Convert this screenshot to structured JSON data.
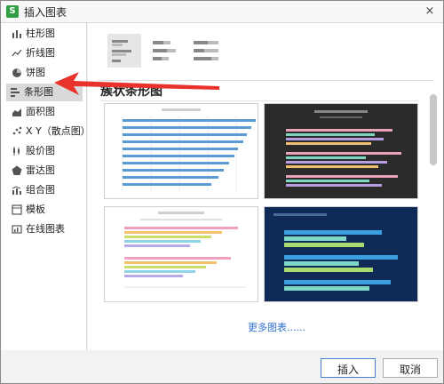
{
  "window": {
    "title": "插入图表",
    "app_icon_letter": "S",
    "close_glyph": "×"
  },
  "sidebar": {
    "items": [
      {
        "label": "柱形图",
        "icon": "column-chart-icon"
      },
      {
        "label": "折线图",
        "icon": "line-chart-icon"
      },
      {
        "label": "饼图",
        "icon": "pie-chart-icon"
      },
      {
        "label": "条形图",
        "icon": "bar-chart-icon",
        "active": true
      },
      {
        "label": "面积图",
        "icon": "area-chart-icon"
      },
      {
        "label": "X Y（散点图）",
        "icon": "scatter-chart-icon"
      },
      {
        "label": "股价图",
        "icon": "stock-chart-icon"
      },
      {
        "label": "雷达图",
        "icon": "radar-chart-icon"
      },
      {
        "label": "组合图",
        "icon": "combo-chart-icon"
      },
      {
        "label": "模板",
        "icon": "template-icon"
      },
      {
        "label": "在线图表",
        "icon": "online-chart-icon"
      }
    ]
  },
  "content": {
    "section_title": "簇状条形图",
    "more_link": "更多图表......",
    "subtypes": [
      "clustered-bar",
      "stacked-bar",
      "percent-stacked-bar"
    ],
    "thumbnails": [
      {
        "style": "light-blue-bars"
      },
      {
        "style": "dark-colorful-bars"
      },
      {
        "style": "light-multicolor-bars"
      },
      {
        "style": "navy-blue-bars"
      }
    ]
  },
  "buttons": {
    "insert": "插入",
    "cancel": "取消"
  },
  "colors": {
    "accent": "#4a7fd6",
    "arrow": "#e8322b",
    "link": "#2e6fd1",
    "bar_blue": "#5b9bd5"
  }
}
